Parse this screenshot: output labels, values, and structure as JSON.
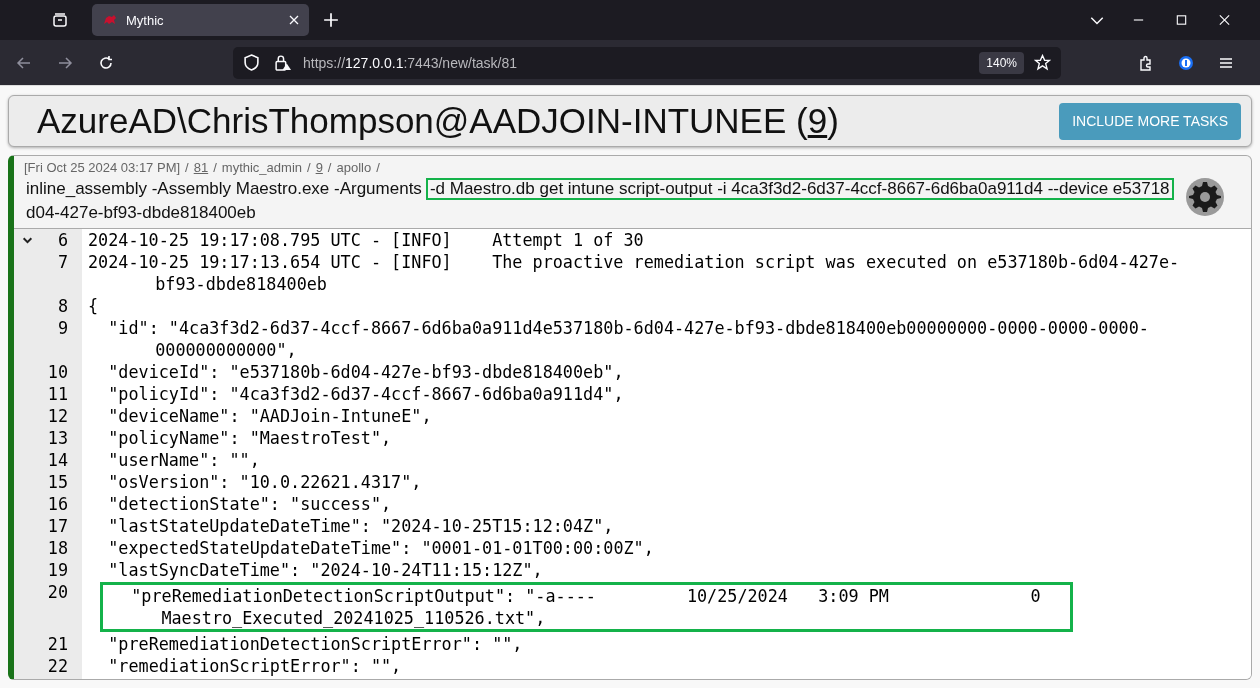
{
  "browser": {
    "tab": {
      "title": "Mythic",
      "selected": true
    },
    "url": {
      "prefix": "https://",
      "host": "127.0.0.1",
      "rest": ":7443/new/task/81"
    },
    "zoom": "140%"
  },
  "header": {
    "title": "AzureAD\\ChrisThompson@AADJOIN-INTUNEE",
    "callback_open": "(",
    "callback_id": "9",
    "callback_close": ")",
    "button": "INCLUDE MORE TASKS"
  },
  "task": {
    "meta": [
      {
        "kind": "text",
        "text": "[Fri Oct 25 2024 03:17 PM]"
      },
      {
        "kind": "separator",
        "text": "/"
      },
      {
        "kind": "link",
        "text": "81"
      },
      {
        "kind": "separator",
        "text": "/"
      },
      {
        "kind": "text",
        "text": "mythic_admin"
      },
      {
        "kind": "separator",
        "text": "/"
      },
      {
        "kind": "link",
        "text": "9"
      },
      {
        "kind": "separator",
        "text": "/"
      },
      {
        "kind": "text",
        "text": "apollo"
      },
      {
        "kind": "separator",
        "text": "/"
      }
    ],
    "command_lines": [
      [
        {
          "text": "inline_assembly -Assembly Maestro.exe -Arguments",
          "highlighted": false
        },
        {
          "text": "-d Maestro.db get intune script-output -i 4ca3f3d2-6d37-4ccf-8667-6d6ba0a911d4 --device e53718",
          "highlighted": true
        }
      ],
      [
        {
          "text": "d04-427e-bf93-dbde818400eb",
          "highlighted": false
        }
      ]
    ],
    "output": [
      {
        "number": "6",
        "text": "2024-10-25 19:17:08.795 UTC - [INFO]    Attempt 1 of 30",
        "collapsible": true,
        "highlighted": false
      },
      {
        "number": "7",
        "text": "2024-10-25 19:17:13.654 UTC - [INFO]    The proactive remediation script was executed on e537180b-6d04-427e-bf93-dbde818400eb",
        "collapsible": false,
        "highlighted": false
      },
      {
        "number": "8",
        "text": "{",
        "collapsible": false,
        "highlighted": false
      },
      {
        "number": "9",
        "text": "  \"id\": \"4ca3f3d2-6d37-4ccf-8667-6d6ba0a911d4e537180b-6d04-427e-bf93-dbde818400eb00000000-0000-0000-0000-000000000000\",",
        "collapsible": false,
        "highlighted": false
      },
      {
        "number": "10",
        "text": "  \"deviceId\": \"e537180b-6d04-427e-bf93-dbde818400eb\",",
        "collapsible": false,
        "highlighted": false
      },
      {
        "number": "11",
        "text": "  \"policyId\": \"4ca3f3d2-6d37-4ccf-8667-6d6ba0a911d4\",",
        "collapsible": false,
        "highlighted": false
      },
      {
        "number": "12",
        "text": "  \"deviceName\": \"AADJoin-IntuneE\",",
        "collapsible": false,
        "highlighted": false
      },
      {
        "number": "13",
        "text": "  \"policyName\": \"MaestroTest\",",
        "collapsible": false,
        "highlighted": false
      },
      {
        "number": "14",
        "text": "  \"userName\": \"\",",
        "collapsible": false,
        "highlighted": false
      },
      {
        "number": "15",
        "text": "  \"osVersion\": \"10.0.22621.4317\",",
        "collapsible": false,
        "highlighted": false
      },
      {
        "number": "16",
        "text": "  \"detectionState\": \"success\",",
        "collapsible": false,
        "highlighted": false
      },
      {
        "number": "17",
        "text": "  \"lastStateUpdateDateTime\": \"2024-10-25T15:12:04Z\",",
        "collapsible": false,
        "highlighted": false
      },
      {
        "number": "18",
        "text": "  \"expectedStateUpdateDateTime\": \"0001-01-01T00:00:00Z\",",
        "collapsible": false,
        "highlighted": false
      },
      {
        "number": "19",
        "text": "  \"lastSyncDateTime\": \"2024-10-24T11:15:12Z\",",
        "collapsible": false,
        "highlighted": false
      },
      {
        "number": "20",
        "text": "  \"preRemediationDetectionScriptOutput\": \"-a----         10/25/2024   3:09 PM              0 Maestro_Executed_20241025_110526.txt\",",
        "collapsible": false,
        "highlighted": true
      },
      {
        "number": "21",
        "text": "  \"preRemediationDetectionScriptError\": \"\",",
        "collapsible": false,
        "highlighted": false
      },
      {
        "number": "22",
        "text": "  \"remediationScriptError\": \"\",",
        "collapsible": false,
        "highlighted": false
      }
    ]
  }
}
